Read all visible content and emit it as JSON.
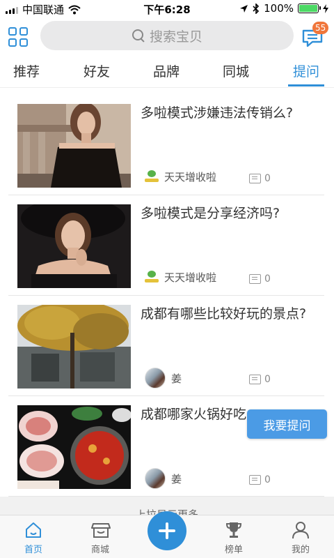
{
  "status_bar": {
    "carrier": "中国联通",
    "time": "下午6:28",
    "battery": "100%"
  },
  "header": {
    "search_placeholder": "搜索宝贝",
    "message_badge": "55"
  },
  "tabs": [
    {
      "label": "推荐",
      "active": false
    },
    {
      "label": "好友",
      "active": false
    },
    {
      "label": "品牌",
      "active": false
    },
    {
      "label": "同城",
      "active": false
    },
    {
      "label": "提问",
      "active": true
    }
  ],
  "feed": [
    {
      "title": "多啦模式涉嫌违法传销么?",
      "author": "天天增收啦",
      "author_icon": "brand-logo-icon",
      "comments": "0"
    },
    {
      "title": "多啦模式是分享经济吗?",
      "author": "天天增收啦",
      "author_icon": "brand-logo-icon",
      "comments": "0"
    },
    {
      "title": "成都有哪些比较好玩的景点?",
      "author": "姜",
      "author_icon": "avatar",
      "comments": "0"
    },
    {
      "title": "成都哪家火锅好吃",
      "author": "姜",
      "author_icon": "avatar",
      "comments": "0"
    }
  ],
  "ask_button": "我要提问",
  "load_more": "上拉显示更多",
  "bottom_nav": [
    {
      "label": "首页",
      "icon": "home-icon",
      "active": true
    },
    {
      "label": "商城",
      "icon": "shop-icon",
      "active": false
    },
    {
      "label": "",
      "icon": "plus-icon",
      "active": false
    },
    {
      "label": "榜单",
      "icon": "trophy-icon",
      "active": false
    },
    {
      "label": "我的",
      "icon": "person-icon",
      "active": false
    }
  ],
  "colors": {
    "accent": "#2f8fd8",
    "badge": "#f0763b",
    "ask_button": "#4b9be5"
  }
}
